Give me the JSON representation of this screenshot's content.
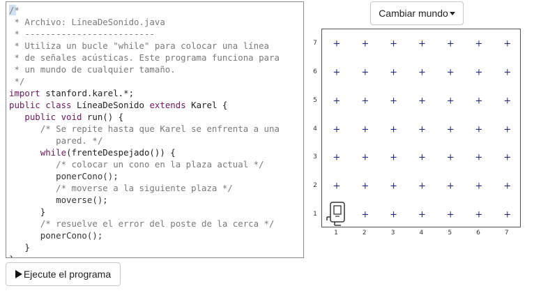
{
  "editor": {
    "lines": [
      [
        {
          "c": "cm",
          "t": "/*"
        }
      ],
      [
        {
          "c": "cm",
          "t": " * Archivo: LíneaDeSonido.java"
        }
      ],
      [
        {
          "c": "cm",
          "t": " * -------------------------"
        }
      ],
      [
        {
          "c": "cm",
          "t": " * Utiliza un bucle \"while\" para colocar una línea"
        }
      ],
      [
        {
          "c": "cm",
          "t": " * de señales acústicas. Este programa funciona para"
        }
      ],
      [
        {
          "c": "cm",
          "t": " * un mundo de cualquier tamaño."
        }
      ],
      [
        {
          "c": "cm",
          "t": " */"
        }
      ],
      [
        {
          "c": "kw",
          "t": "import"
        },
        {
          "c": "plain",
          "t": " stanford.karel.*;"
        }
      ],
      [
        {
          "c": "kw",
          "t": "public class"
        },
        {
          "c": "plain",
          "t": " LíneaDeSonido "
        },
        {
          "c": "kw",
          "t": "extends"
        },
        {
          "c": "plain",
          "t": " Karel {"
        }
      ],
      [
        {
          "c": "kw",
          "t": "   public void"
        },
        {
          "c": "plain",
          "t": " run() {"
        }
      ],
      [
        {
          "c": "cm",
          "t": "      /* Se repite hasta que Karel se enfrenta a una"
        }
      ],
      [
        {
          "c": "cm",
          "t": "         pared. */"
        }
      ],
      [
        {
          "c": "kw",
          "t": "      while"
        },
        {
          "c": "plain",
          "t": "(frenteDespejado()) {"
        }
      ],
      [
        {
          "c": "cm",
          "t": "         /* colocar un cono en la plaza actual */"
        }
      ],
      [
        {
          "c": "fn",
          "t": "         ponerCono();"
        }
      ],
      [
        {
          "c": "cm",
          "t": "         /* moverse a la siguiente plaza */"
        }
      ],
      [
        {
          "c": "fn",
          "t": "         moverse();"
        }
      ],
      [
        {
          "c": "plain",
          "t": "      }"
        }
      ],
      [
        {
          "c": "cm",
          "t": "      /* resuelve el error del poste de la cerca */"
        }
      ],
      [
        {
          "c": "fn",
          "t": "      ponerCono();"
        }
      ],
      [
        {
          "c": "plain",
          "t": "   }"
        }
      ],
      [
        {
          "c": "plain",
          "t": "}"
        }
      ]
    ]
  },
  "buttons": {
    "run_label": "Ejecute el programa",
    "world_label": "Cambiar mundo"
  },
  "world": {
    "columns": 7,
    "rows": 7,
    "x_labels": [
      "1",
      "2",
      "3",
      "4",
      "5",
      "6",
      "7"
    ],
    "y_labels": [
      "1",
      "2",
      "3",
      "4",
      "5",
      "6",
      "7"
    ],
    "corner_glyph": "+",
    "karel": {
      "column": 1,
      "row": 1,
      "facing": "east"
    }
  },
  "colors": {
    "comment": "#7a7a7a",
    "keyword": "#6a1a5a",
    "corner_mark": "#2a2a7a"
  },
  "icons": {
    "run_button": "play-icon",
    "world_button": "caret-down-icon",
    "robot": "karel-robot-icon"
  }
}
